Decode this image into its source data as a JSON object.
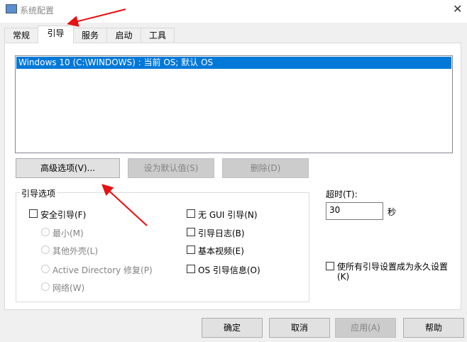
{
  "window": {
    "title": "系统配置",
    "close": "✕"
  },
  "tabs": [
    {
      "label": "常规"
    },
    {
      "label": "引导"
    },
    {
      "label": "服务"
    },
    {
      "label": "启动"
    },
    {
      "label": "工具"
    }
  ],
  "os_list": [
    "Windows 10 (C:\\WINDOWS) : 当前 OS; 默认 OS"
  ],
  "buttons": {
    "advanced": "高级选项(V)...",
    "set_default": "设为默认值(S)",
    "delete": "删除(D)",
    "ok": "确定",
    "cancel": "取消",
    "apply": "应用(A)",
    "help": "帮助"
  },
  "boot_options": {
    "title": "引导选项",
    "safe_boot": "安全引导(F)",
    "minimal": "最小(M)",
    "alt_shell": "其他外壳(L)",
    "ad_repair": "Active Directory 修复(P)",
    "network": "网络(W)",
    "no_gui": "无 GUI 引导(N)",
    "boot_log": "引导日志(B)",
    "base_video": "基本视频(E)",
    "os_info": "OS 引导信息(O)"
  },
  "timeout": {
    "label": "超时(T):",
    "value": "30",
    "unit": "秒"
  },
  "permanent": {
    "label_line1": "使所有引导设置成为永久设置",
    "label_line2": "(K)"
  },
  "colors": {
    "selection": "#0078d7",
    "arrow": "#e81010"
  }
}
